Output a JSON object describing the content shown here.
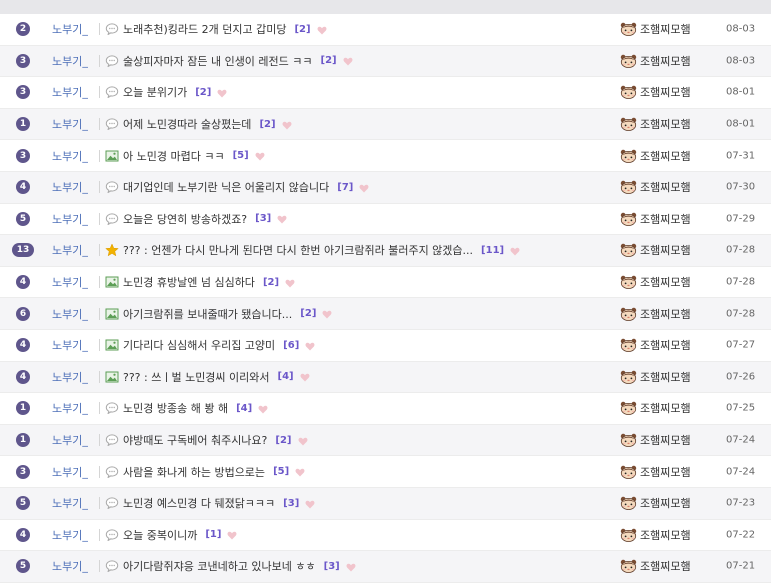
{
  "rows": [
    {
      "badge": "2",
      "category": "노부기_",
      "type": "chat",
      "title": "노래추천)킹라드 2개 던지고 갑미당",
      "comments": "[2]",
      "author": "조햄찌모햄",
      "date": "08-03"
    },
    {
      "badge": "3",
      "category": "노부기_",
      "type": "chat",
      "title": "술상피자마자 잠든 내 인생이 레전드 ㅋㅋ",
      "comments": "[2]",
      "author": "조햄찌모햄",
      "date": "08-03"
    },
    {
      "badge": "3",
      "category": "노부기_",
      "type": "chat",
      "title": "오늘 분위기가",
      "comments": "[2]",
      "author": "조햄찌모햄",
      "date": "08-01"
    },
    {
      "badge": "1",
      "category": "노부기_",
      "type": "chat",
      "title": "어제 노민경따라 술상폈는데",
      "comments": "[2]",
      "author": "조햄찌모햄",
      "date": "08-01"
    },
    {
      "badge": "3",
      "category": "노부기_",
      "type": "image",
      "title": "아 노민경 마렵다 ㅋㅋ",
      "comments": "[5]",
      "author": "조햄찌모햄",
      "date": "07-31"
    },
    {
      "badge": "4",
      "category": "노부기_",
      "type": "chat",
      "title": "대기업인데 노부기란 닉은 어울리지 않습니다",
      "comments": "[7]",
      "author": "조햄찌모햄",
      "date": "07-30"
    },
    {
      "badge": "5",
      "category": "노부기_",
      "type": "chat",
      "title": "오늘은 당연히 방송하겠죠?",
      "comments": "[3]",
      "author": "조햄찌모햄",
      "date": "07-29"
    },
    {
      "badge": "13",
      "category": "노부기_",
      "type": "star",
      "title": "??? : 언젠가 다시 만나게 된다면 다시 한번 아기크람쥐라 불러주지 않겠습...",
      "comments": "[11]",
      "author": "조햄찌모햄",
      "date": "07-28"
    },
    {
      "badge": "4",
      "category": "노부기_",
      "type": "image",
      "title": "노민경 휴방날엔 넘 심심하다",
      "comments": "[2]",
      "author": "조햄찌모햄",
      "date": "07-28"
    },
    {
      "badge": "6",
      "category": "노부기_",
      "type": "image",
      "title": "아기크람쥐를 보내줄때가 됐습니다...",
      "comments": "[2]",
      "author": "조햄찌모햄",
      "date": "07-28"
    },
    {
      "badge": "4",
      "category": "노부기_",
      "type": "image",
      "title": "기다리다 심심해서 우리집 고양미",
      "comments": "[6]",
      "author": "조햄찌모햄",
      "date": "07-27"
    },
    {
      "badge": "4",
      "category": "노부기_",
      "type": "image",
      "title": "??? : 쓰ㅣ벌 노민경씨 이리와서",
      "comments": "[4]",
      "author": "조햄찌모햄",
      "date": "07-26"
    },
    {
      "badge": "1",
      "category": "노부기_",
      "type": "chat",
      "title": "노민경 방종송 해 봥 해",
      "comments": "[4]",
      "author": "조햄찌모햄",
      "date": "07-25"
    },
    {
      "badge": "1",
      "category": "노부기_",
      "type": "chat",
      "title": "야방때도 구독베어 춰주시나요?",
      "comments": "[2]",
      "author": "조햄찌모햄",
      "date": "07-24"
    },
    {
      "badge": "3",
      "category": "노부기_",
      "type": "chat",
      "title": "사람을 화나게 하는 방법으로는",
      "comments": "[5]",
      "author": "조햄찌모햄",
      "date": "07-24"
    },
    {
      "badge": "5",
      "category": "노부기_",
      "type": "chat",
      "title": "노민경 예스민경 다 뒈졌닭ㅋㅋㅋ",
      "comments": "[3]",
      "author": "조햄찌모햄",
      "date": "07-23"
    },
    {
      "badge": "4",
      "category": "노부기_",
      "type": "chat",
      "title": "오늘 중복이니까",
      "comments": "[1]",
      "author": "조햄찌모햄",
      "date": "07-22"
    },
    {
      "badge": "5",
      "category": "노부기_",
      "type": "chat",
      "title": "아기다람쥐쟈응 코낸네하고 있나보네 ㅎㅎ",
      "comments": "[3]",
      "author": "조햄찌모햄",
      "date": "07-21"
    }
  ],
  "colors": {
    "badge": "#5f568c",
    "category": "#4d6fb8",
    "comment_count": "#6b57c9",
    "heart": "#f1c4cc"
  },
  "icons": {
    "chat": "speech-bubble-icon",
    "image": "image-icon",
    "star": "star-icon",
    "heart": "heart-icon",
    "author": "hamster-face-icon"
  }
}
